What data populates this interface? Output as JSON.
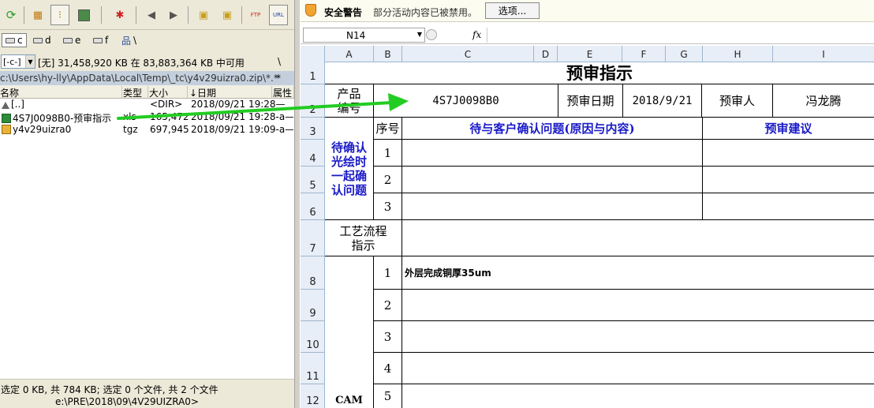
{
  "file_manager": {
    "drives": [
      {
        "label": "c",
        "active": true
      },
      {
        "label": "d",
        "active": false
      },
      {
        "label": "e",
        "active": false
      },
      {
        "label": "f",
        "active": false
      },
      {
        "label": "\\",
        "active": false
      }
    ],
    "drive_select": "[-c-]",
    "space_info": "[无] 31,458,920 KB 在 83,883,364 KB 中可用",
    "root_button": "\\",
    "path": "c:\\Users\\hy-lly\\AppData\\Local\\Temp\\_tc\\y4v29uizra0.zip\\*.*",
    "path_filter": "*",
    "columns": {
      "name": "名称",
      "type": "类型",
      "size": "大小",
      "date": "↓日期",
      "attr": "属性"
    },
    "files": [
      {
        "icon": "up-dir-icon",
        "name": "[..]",
        "type": "",
        "size": "<DIR>",
        "date": "2018/09/21 19:28—"
      },
      {
        "icon": "excel-file-icon",
        "name": "4S7J0098B0-预审指示",
        "type": "xls",
        "size": "165,472",
        "date": "2018/09/21 19:28-a—"
      },
      {
        "icon": "archive-file-icon",
        "name": "y4v29uizra0",
        "type": "tgz",
        "size": "697,945",
        "date": "2018/09/21 19:09-a—"
      }
    ],
    "status": "选定 0 KB, 共 784 KB; 选定 0 个文件, 共 2 个文件",
    "command_path": "e:\\PRE\\2018\\09\\4V29UIZRA0>"
  },
  "excel": {
    "security_title": "安全警告",
    "security_message": "部分活动内容已被禁用。",
    "options_label": "选项...",
    "name_box": "N14",
    "fx_label": "fx",
    "columns": [
      "A",
      "B",
      "C",
      "D",
      "E",
      "F",
      "G",
      "H",
      "I"
    ],
    "rows": [
      "1",
      "2",
      "3",
      "4",
      "5",
      "6",
      "7",
      "8",
      "9",
      "10",
      "11",
      "12"
    ],
    "title": "预审指示",
    "product_code_label": "产品编号",
    "product_code": "4S7J0098B0",
    "review_date_label": "预审日期",
    "review_date": "2018/9/21",
    "reviewer_label": "预审人",
    "reviewer": "冯龙腾",
    "seq_label": "序号",
    "issue_header": "待与客户确认问题(原因与内容)",
    "suggestion_header": "预审建议",
    "confirm_label": "待确认光绘时一起确认问题",
    "confirm_nums": [
      "1",
      "2",
      "3"
    ],
    "process_label": "工艺流程指示",
    "cam_label": "CAM",
    "cam_nums": [
      "1",
      "2",
      "3",
      "4",
      "5"
    ],
    "cam_item_1": "外层完成铜厚35um"
  },
  "colors": {
    "accent_blue": "#1a1ac8",
    "drag_arrow": "#22cc22",
    "path_highlight": "#c4cfdd"
  }
}
